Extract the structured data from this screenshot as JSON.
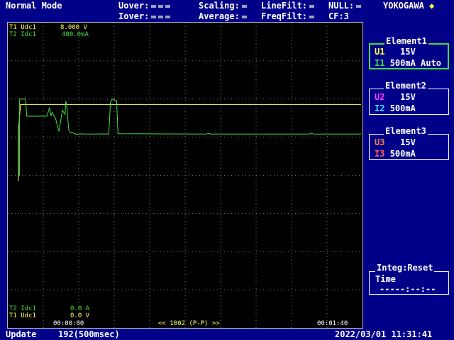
{
  "header": {
    "mode": "Normal Mode",
    "uover": "Uover:",
    "iover": "Iover:",
    "scaling": "Scaling:",
    "average": "Average:",
    "linefilt": "LineFilt:",
    "freqfilt": "FreqFilt:",
    "null": "NULL:",
    "cf": "CF:3",
    "brand": "YOKOGAWA"
  },
  "traces": {
    "t1_label": "T1 Udc1",
    "t1_value": "8.000 V",
    "t2_label": "T2 Idc1",
    "t2_value": "400.0mA",
    "t2_bottom_label": "T2 Idc1",
    "t2_bottom_value": "0.0 A",
    "t1_bottom_label": "T1 Udc1",
    "t1_bottom_value": "0.0 V",
    "time_start": "00:00:00",
    "record": "<< 1002 (P-P) >>",
    "time_end": "00:01:40"
  },
  "elements": [
    {
      "title": "Element1",
      "u_name": "U1",
      "u_range": "15V",
      "i_name": "I1",
      "i_range": "500mA Auto",
      "u_color": "#ffff40",
      "i_color": "#40e040",
      "border": "#40e040"
    },
    {
      "title": "Element2",
      "u_name": "U2",
      "u_range": "15V",
      "i_name": "I2",
      "i_range": "500mA",
      "u_color": "#ff40ff",
      "i_color": "#40e0ff",
      "border": "#ffffff"
    },
    {
      "title": "Element3",
      "u_name": "U3",
      "u_range": "15V",
      "i_name": "I3",
      "i_range": "500mA",
      "u_color": "#ff8040",
      "i_color": "#ff6060",
      "border": "#ffffff"
    }
  ],
  "integ": {
    "title": "Integ:Reset",
    "time_label": "Time",
    "time_value": "-----:--:--"
  },
  "footer": {
    "update_label": "Update",
    "update_value": "192(500msec)",
    "datetime": "2022/03/01 11:31:41"
  },
  "chart_data": {
    "type": "line",
    "series": [
      {
        "name": "T1 Udc1",
        "color": "#ffff60",
        "points": [
          [
            0,
            0
          ],
          [
            0.2,
            0
          ],
          [
            0.2,
            5
          ],
          [
            0.8,
            7.7
          ],
          [
            100,
            7.7
          ]
        ]
      },
      {
        "name": "T2 Idc1",
        "color": "#40e040",
        "points": [
          [
            0,
            0
          ],
          [
            0.5,
            0
          ],
          [
            0.5,
            400
          ],
          [
            2.3,
            400
          ],
          [
            2.6,
            310
          ],
          [
            8.5,
            310
          ],
          [
            9.0,
            340
          ],
          [
            9.3,
            355
          ],
          [
            9.7,
            310
          ],
          [
            10.0,
            330
          ],
          [
            11.0,
            300
          ],
          [
            12.0,
            230
          ],
          [
            13.0,
            340
          ],
          [
            13.8,
            320
          ],
          [
            14.0,
            390
          ],
          [
            14.3,
            360
          ],
          [
            14.6,
            290
          ],
          [
            14.9,
            235
          ],
          [
            15.3,
            225
          ],
          [
            16.2,
            222
          ],
          [
            17.0,
            215
          ],
          [
            18.0,
            217
          ],
          [
            20.0,
            216
          ],
          [
            25.0,
            217
          ],
          [
            26.5,
            216
          ],
          [
            27.0,
            380
          ],
          [
            27.5,
            400
          ],
          [
            28.8,
            390
          ],
          [
            29.2,
            218
          ],
          [
            55.0,
            216
          ],
          [
            55.6,
            220
          ],
          [
            56.2,
            216
          ],
          [
            85.0,
            216
          ],
          [
            85.6,
            220
          ],
          [
            86.2,
            216
          ],
          [
            100,
            216
          ]
        ]
      }
    ],
    "xlim": [
      0,
      100
    ],
    "ylim_t1": [
      -15,
      16
    ],
    "ylim_t2": [
      -800,
      800
    ]
  }
}
